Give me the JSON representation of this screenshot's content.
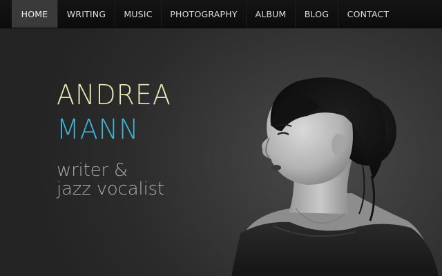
{
  "nav": {
    "items": [
      {
        "label": "HOME",
        "active": true
      },
      {
        "label": "WRITING",
        "active": false
      },
      {
        "label": "MUSIC",
        "active": false
      },
      {
        "label": "PHOTOGRAPHY",
        "active": false
      },
      {
        "label": "ALBUM",
        "active": false
      },
      {
        "label": "BLOG",
        "active": false
      },
      {
        "label": "CONTACT",
        "active": false
      }
    ]
  },
  "hero": {
    "first_name": "ANDREA",
    "last_name": "MANN",
    "tagline_line1": "writer  &",
    "tagline_line2": "jazz vocalist"
  },
  "colors": {
    "first_name": "#ece7b5",
    "last_name": "#3fb3d6",
    "tagline": "#a9a9a9",
    "nav_active_bg": "#3a3a3a"
  },
  "image": {
    "subject_icon": "portrait-photo"
  }
}
